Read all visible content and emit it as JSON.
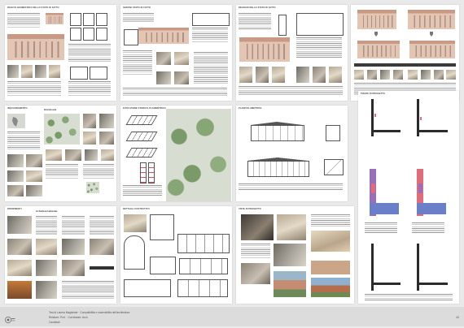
{
  "boards": {
    "b1": {
      "title": "Rilievo geometrico dello stato di fatto"
    },
    "b2": {
      "title": "Sezioni stato di fatto"
    },
    "b3": {
      "title": "Degradi dello stato di fatto"
    },
    "b5": {
      "title": "Inquadramento",
      "sub": "Domodossola"
    },
    "b6": {
      "title": "Evoluzione storico-planimetrica"
    },
    "b7": {
      "title": "Planivolumetrico"
    },
    "b8": {
      "title": "Sezioni di progetto"
    },
    "b9": {
      "title": "Piante di progetto"
    },
    "b10": {
      "title": "Riferimenti",
      "col2": "Architettura tradizionale"
    },
    "b11": {
      "title": "Dettagli costruttivi"
    },
    "b12": {
      "title": "Viste di progetto"
    }
  },
  "footer": {
    "line1": "Tesi di Laurea Magistrale · Compatibilità e sostenibilità dell'architettura",
    "line2": "Relatore: Prof. · Correlatore: Arch.",
    "line3": "Candidati",
    "page": "43"
  }
}
